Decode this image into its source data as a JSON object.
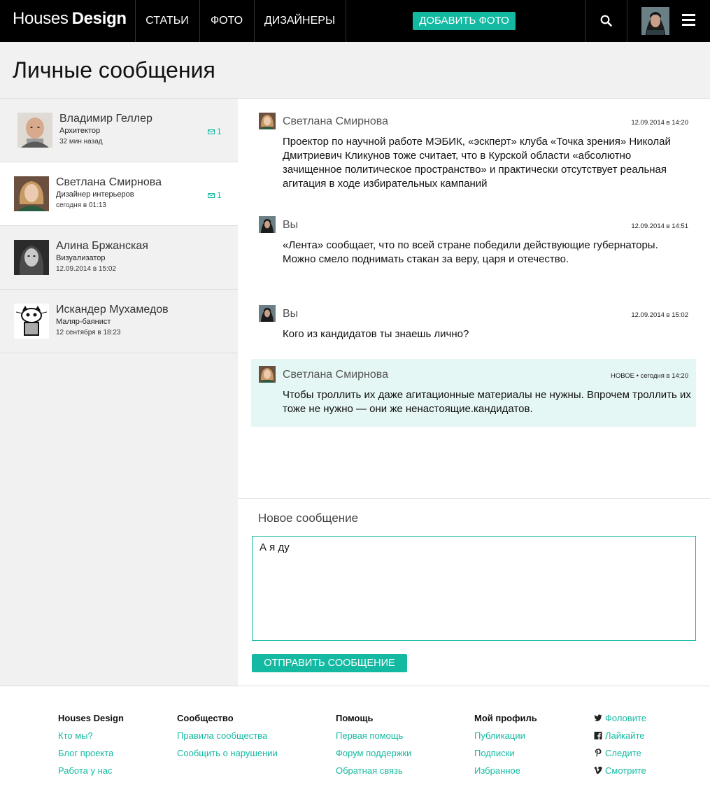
{
  "header": {
    "logo_light": "Houses",
    "logo_bold": "Design",
    "nav": [
      "СТАТЬИ",
      "ФОТО",
      "ДИЗАЙНЕРЫ"
    ],
    "add_photo": "ДОБАВИТЬ ФОТО",
    "search_icon": "search-icon",
    "menu_icon": "hamburger-menu-icon"
  },
  "page": {
    "title": "Личные сообщения"
  },
  "contacts": [
    {
      "name": "Владимир Геллер",
      "role": "Архитектор",
      "time": "32 мин назад",
      "unread": "1"
    },
    {
      "name": "Светлана Смирнова",
      "role": "Дизайнер интерьеров",
      "time": "сегодня в 01:13",
      "unread": "1"
    },
    {
      "name": "Алина Бржанская",
      "role": "Визуализатор",
      "time": "12.09.2014 в 15:02"
    },
    {
      "name": "Искандер Мухамедов",
      "role": "Маляр-баянист",
      "time": "12 сентября в 18:23"
    }
  ],
  "messages": [
    {
      "author": "Светлана Смирнова",
      "time": "12.09.2014 в 14:20",
      "lines": [
        "Проектор по научной работе МЭБИК, «эскперт» клуба «Точка зрения» Николай Дмитриевич Кликунов тоже считает, что в Курской области «абсолютно зачищенное политическое пространство» и практически отсутствует реальная агитация в ходе избирательных кампаний"
      ]
    },
    {
      "author": "Вы",
      "time": "12.09.2014 в 14:51",
      "lines": [
        "«Лента» сообщает, что по всей стране победили действующие губернаторы.",
        "Можно смело поднимать стакан за веру, царя и отечество."
      ]
    },
    {
      "author": "Вы",
      "time": "12.09.2014 в 15:02",
      "lines": [
        "Кого из кандидатов ты знаешь лично?"
      ]
    },
    {
      "author": "Светлана Смирнова",
      "time": "НОВОЕ • сегодня в 14:20",
      "lines": [
        "Чтобы троллить их даже агитационные материалы не нужны. Впрочем троллить их тоже не нужно — они же ненастоящие.кандидатов."
      ]
    }
  ],
  "composer": {
    "label": "Новое сообщение",
    "value": "А я ду",
    "send": "ОТПРАВИТЬ СООБЩЕНИЕ"
  },
  "footer": {
    "columns": [
      {
        "title": "Houses Design",
        "links": [
          "Кто мы?",
          "Блог проекта",
          "Работа у нас"
        ]
      },
      {
        "title": "Сообщество",
        "links": [
          "Правила сообщества",
          "Сообщить о нарушении"
        ]
      },
      {
        "title": "Помощь",
        "links": [
          "Первая помощь",
          "Форум поддержки",
          "Обратная связь"
        ]
      },
      {
        "title": "Мой профиль",
        "links": [
          "Публикации",
          "Подписки",
          "Избранное"
        ]
      }
    ],
    "social": [
      {
        "label": "Фоловите",
        "icon": "twitter-icon"
      },
      {
        "label": "Лайкайте",
        "icon": "facebook-icon"
      },
      {
        "label": "Следите",
        "icon": "pinterest-icon"
      },
      {
        "label": "Смотрите",
        "icon": "vimeo-icon"
      }
    ]
  },
  "colors": {
    "accent": "#14b9a1",
    "header_bg": "#000000",
    "panel_bg": "#f1f1f1",
    "new_msg_bg": "#e5f7f4"
  }
}
